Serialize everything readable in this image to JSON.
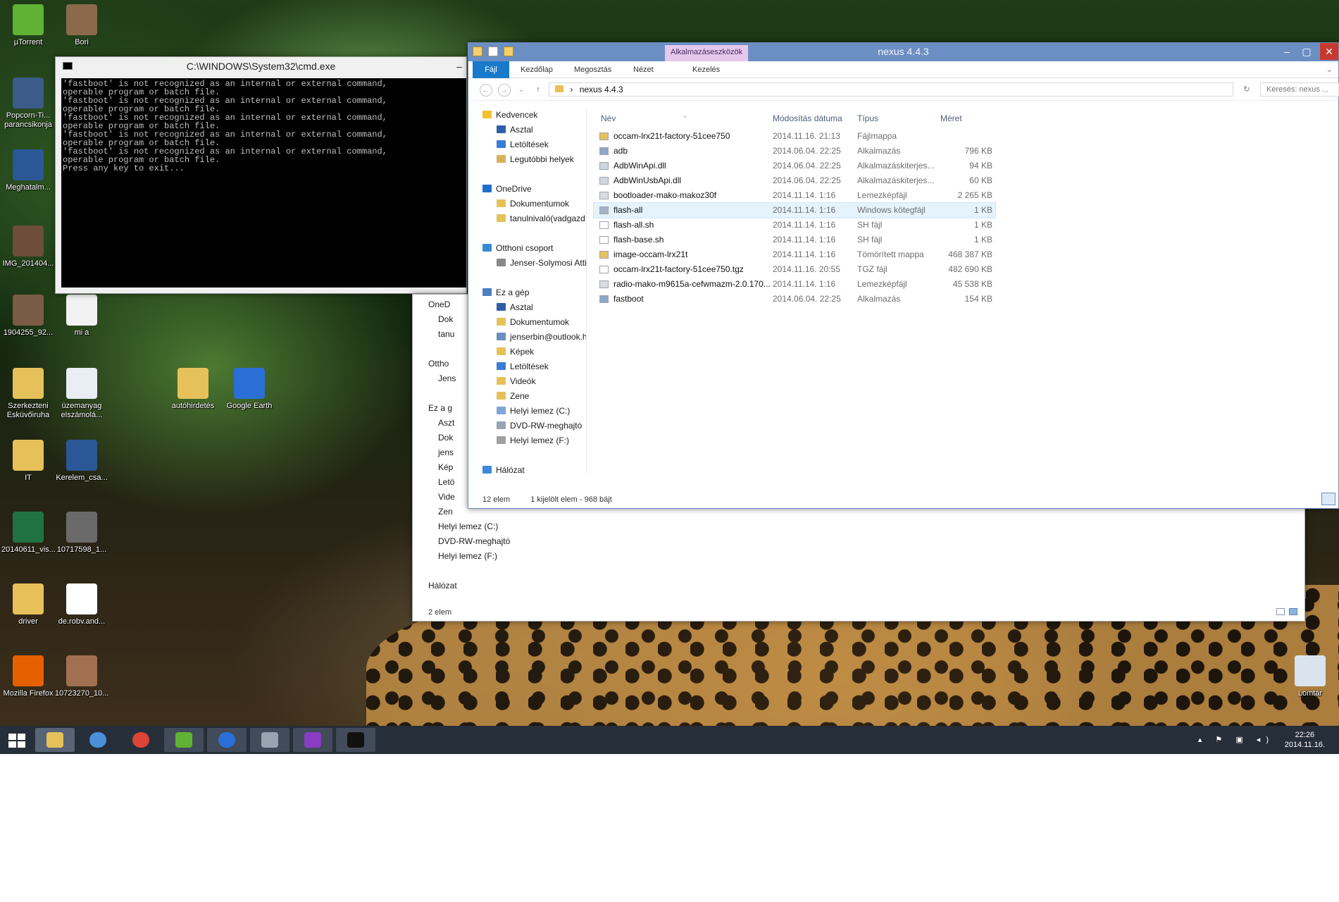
{
  "desktop_icons": [
    {
      "label": "µTorrent",
      "color": "#5fb234"
    },
    {
      "label": "Bori",
      "color": "#8a6a4a"
    },
    {
      "label": "Popcorn-Ti... parancsikonja",
      "color": "#3b5b88"
    },
    {
      "label": "Meghatalm...",
      "color": "#2b5797"
    },
    {
      "label": "IMG_201404...",
      "color": "#6e4d3a"
    },
    {
      "label": "1904255_92...",
      "color": "#7a5b46"
    },
    {
      "label": "mi a",
      "color": "#f2f2f2"
    },
    {
      "label": "Szerkezteni Esküvőiruha",
      "color": "#e6c15a"
    },
    {
      "label": "üzemanyag elszámolá...",
      "color": "#e9eef5"
    },
    {
      "label": "autóhirdetés",
      "color": "#e6c15a"
    },
    {
      "label": "Google Earth",
      "color": "#2a6fd6"
    },
    {
      "label": "IT",
      "color": "#e6c15a"
    },
    {
      "label": "Kerelem_csa...",
      "color": "#2b5797"
    },
    {
      "label": "20140611_vis...",
      "color": "#207245"
    },
    {
      "label": "10717598_1...",
      "color": "#6a6a6a"
    },
    {
      "label": "driver",
      "color": "#e6c15a"
    },
    {
      "label": "de.robv.and...",
      "color": "#ffffff"
    },
    {
      "label": "Mozilla Firefox",
      "color": "#e66000"
    },
    {
      "label": "10723270_10...",
      "color": "#a07050"
    },
    {
      "label": "Lomtár",
      "color": "#d9e4ee"
    }
  ],
  "cmd": {
    "title": "C:\\WINDOWS\\System32\\cmd.exe",
    "minimize": "–",
    "output": "'fastboot' is not recognized as an internal or external command,\noperable program or batch file.\n'fastboot' is not recognized as an internal or external command,\noperable program or batch file.\n'fastboot' is not recognized as an internal or external command,\noperable program or batch file.\n'fastboot' is not recognized as an internal or external command,\noperable program or batch file.\n'fastboot' is not recognized as an internal or external command,\noperable program or batch file.\nPress any key to exit..."
  },
  "back_explorer": {
    "nav": [
      "OneD",
      "Dok",
      "tanu",
      "",
      "Ottho",
      "Jens",
      "",
      "Ez a g",
      "Aszt",
      "Dok",
      "jens",
      "Kép",
      "Letö",
      "Vide",
      "Zen",
      "Helyi lemez (C:)",
      "DVD-RW-meghajtó",
      "Helyi lemez (F:)",
      "",
      "Hálózat"
    ],
    "status": "2 elem"
  },
  "explorer": {
    "title": "nexus 4.4.3",
    "context_tab": "Alkalmazáseszközök",
    "tabs": [
      "Fájl",
      "Kezdőlap",
      "Megosztás",
      "Nézet"
    ],
    "context_subtab": "Kezelés",
    "path_root": "›",
    "path": "nexus 4.4.3",
    "search_placeholder": "Keresés: nexus ...",
    "nav": [
      {
        "label": "Kedvencek",
        "color": "#f2c12e"
      },
      {
        "label": "Asztal",
        "color": "#2f5ea8"
      },
      {
        "label": "Letöltések",
        "color": "#3a7bd5"
      },
      {
        "label": "Legutóbbi helyek",
        "color": "#d8b25a"
      },
      {
        "label": "",
        "color": ""
      },
      {
        "label": "OneDrive",
        "color": "#1f6fd1"
      },
      {
        "label": "Dokumentumok",
        "color": "#e6c15a"
      },
      {
        "label": "tanulnivaló(vadgazd",
        "color": "#e6c15a"
      },
      {
        "label": "",
        "color": ""
      },
      {
        "label": "Otthoni csoport",
        "color": "#3b8ad8"
      },
      {
        "label": "Jenser-Solymosi Atti",
        "color": "#888888"
      },
      {
        "label": "",
        "color": ""
      },
      {
        "label": "Ez a gép",
        "color": "#4b7fc0"
      },
      {
        "label": "Asztal",
        "color": "#2f5ea8"
      },
      {
        "label": "Dokumentumok",
        "color": "#e6c15a"
      },
      {
        "label": "jenserbin@outlook.h",
        "color": "#6a8fc0"
      },
      {
        "label": "Képek",
        "color": "#e6c15a"
      },
      {
        "label": "Letöltések",
        "color": "#3a7bd5"
      },
      {
        "label": "Videók",
        "color": "#e6c15a"
      },
      {
        "label": "Zene",
        "color": "#e6c15a"
      },
      {
        "label": "Helyi lemez (C:)",
        "color": "#7fa6d4"
      },
      {
        "label": "DVD-RW-meghajtó",
        "color": "#9aa4b0"
      },
      {
        "label": "Helyi lemez (F:)",
        "color": "#a0a0a0"
      },
      {
        "label": "",
        "color": ""
      },
      {
        "label": "Hálózat",
        "color": "#3b8ad8"
      }
    ],
    "columns": {
      "name": "Név",
      "date": "Módosítás dátuma",
      "type": "Típus",
      "size": "Méret"
    },
    "files": [
      {
        "name": "occam-lrx21t-factory-51cee750",
        "date": "2014.11.16. 21:13",
        "type": "Fájlmappa",
        "size": "",
        "icon": "#e6c15a"
      },
      {
        "name": "adb",
        "date": "2014.06.04. 22:25",
        "type": "Alkalmazás",
        "size": "796 KB",
        "icon": "#8fa6c4"
      },
      {
        "name": "AdbWinApi.dll",
        "date": "2014.06.04. 22:25",
        "type": "Alkalmazáskiterjes...",
        "size": "94 KB",
        "icon": "#cfd6de"
      },
      {
        "name": "AdbWinUsbApi.dll",
        "date": "2014.06.04. 22:25",
        "type": "Alkalmazáskiterjes...",
        "size": "60 KB",
        "icon": "#cfd6de"
      },
      {
        "name": "bootloader-mako-makoz30f",
        "date": "2014.11.14. 1:16",
        "type": "Lemezképfájl",
        "size": "2 265 KB",
        "icon": "#d9dde2"
      },
      {
        "name": "flash-all",
        "date": "2014.11.14. 1:16",
        "type": "Windows kötegfájl",
        "size": "1 KB",
        "icon": "#a5b3c4"
      },
      {
        "name": "flash-all.sh",
        "date": "2014.11.14. 1:16",
        "type": "SH fájl",
        "size": "1 KB",
        "icon": "#ffffff"
      },
      {
        "name": "flash-base.sh",
        "date": "2014.11.14. 1:16",
        "type": "SH fájl",
        "size": "1 KB",
        "icon": "#ffffff"
      },
      {
        "name": "image-occam-lrx21t",
        "date": "2014.11.14. 1:16",
        "type": "Tömörített mappa",
        "size": "468 387 KB",
        "icon": "#e6c15a"
      },
      {
        "name": "occam-lrx21t-factory-51cee750.tgz",
        "date": "2014.11.16. 20:55",
        "type": "TGZ fájl",
        "size": "482 690 KB",
        "icon": "#ffffff"
      },
      {
        "name": "radio-mako-m9615a-cefwmazm-2.0.170...",
        "date": "2014.11.14. 1:16",
        "type": "Lemezképfájl",
        "size": "45 538 KB",
        "icon": "#d9dde2"
      },
      {
        "name": "fastboot",
        "date": "2014.06.04. 22:25",
        "type": "Alkalmazás",
        "size": "154 KB",
        "icon": "#8fa6c4"
      }
    ],
    "selected_index": 5,
    "status_count": "12 elem",
    "status_selection": "1 kijelölt elem - 968 bájt"
  },
  "taskbar": {
    "apps": [
      {
        "name": "file-explorer",
        "color": "#e6c15a"
      },
      {
        "name": "internet-explorer-app",
        "color": "#4a90d9"
      },
      {
        "name": "chrome",
        "color": "#db4437"
      },
      {
        "name": "utorrent",
        "color": "#5fb234"
      },
      {
        "name": "earth-browser",
        "color": "#2a6fd6"
      },
      {
        "name": "remote-app",
        "color": "#9aa4b0"
      },
      {
        "name": "search-app",
        "color": "#8a3cc2"
      },
      {
        "name": "cmd-app",
        "color": "#111111"
      }
    ],
    "tray_icons": "▴ ⚑ ▣ ◂)",
    "time": "22:26",
    "date": "2014.11.16."
  }
}
